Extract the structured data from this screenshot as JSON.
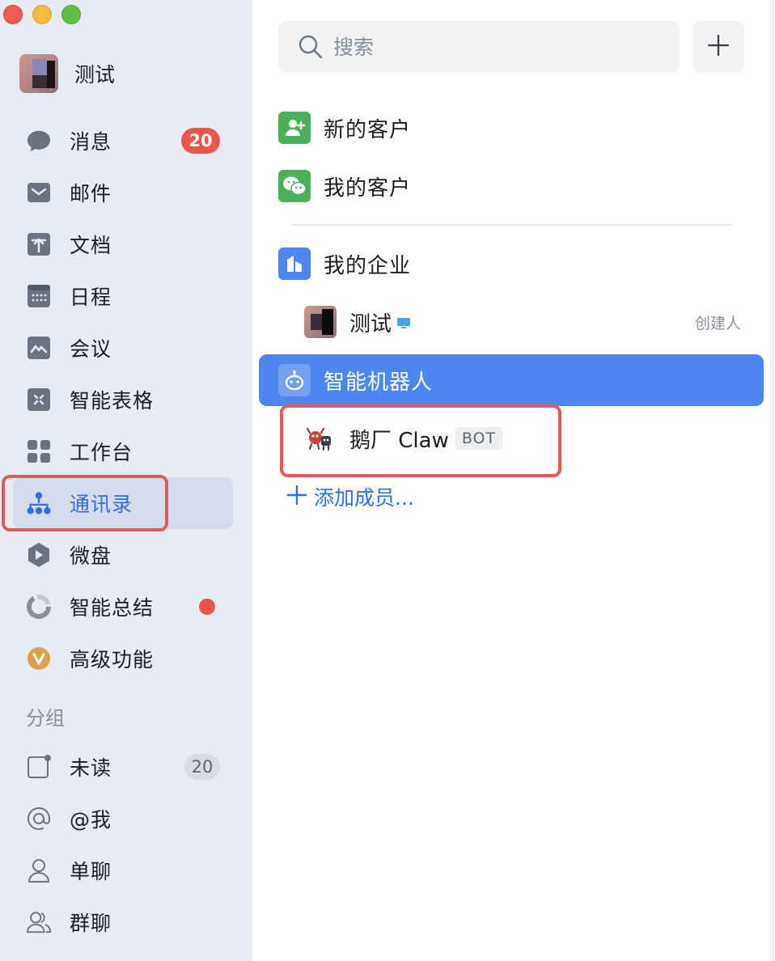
{
  "window": {
    "controls": [
      "close",
      "minimize",
      "maximize"
    ]
  },
  "profile": {
    "name": "测试"
  },
  "sidebar": {
    "items": [
      {
        "label": "消息",
        "icon": "chat-bubble-icon",
        "badge": "20"
      },
      {
        "label": "邮件",
        "icon": "mail-icon"
      },
      {
        "label": "文档",
        "icon": "document-icon"
      },
      {
        "label": "日程",
        "icon": "calendar-icon"
      },
      {
        "label": "会议",
        "icon": "meeting-icon"
      },
      {
        "label": "智能表格",
        "icon": "smart-sheet-icon"
      },
      {
        "label": "工作台",
        "icon": "workbench-grid-icon"
      },
      {
        "label": "通讯录",
        "icon": "contacts-org-icon",
        "active": true
      },
      {
        "label": "微盘",
        "icon": "drive-icon"
      },
      {
        "label": "智能总结",
        "icon": "ai-summary-icon",
        "dot": true
      },
      {
        "label": "高级功能",
        "icon": "premium-icon"
      }
    ],
    "group_title": "分组",
    "groups": [
      {
        "label": "未读",
        "icon": "unread-icon",
        "badge": "20"
      },
      {
        "label": "@我",
        "icon": "at-icon"
      },
      {
        "label": "单聊",
        "icon": "person-icon"
      },
      {
        "label": "群聊",
        "icon": "group-icon"
      }
    ]
  },
  "search": {
    "placeholder": "搜索",
    "value": ""
  },
  "contacts": {
    "new_customers": "新的客户",
    "my_customers": "我的客户",
    "my_company": "我的企业",
    "member": {
      "name": "测试",
      "role": "创建人"
    },
    "bot_group": "智能机器人",
    "bot": {
      "name": "鹅厂 Claw",
      "tag": "BOT"
    },
    "add_member": "添加成员..."
  },
  "colors": {
    "accent": "#2f6ee5",
    "selected_row": "#4c86ee",
    "badge_red": "#e8574b",
    "sidebar_bg": "#e8ebf4",
    "highlight": "#de5b57"
  }
}
